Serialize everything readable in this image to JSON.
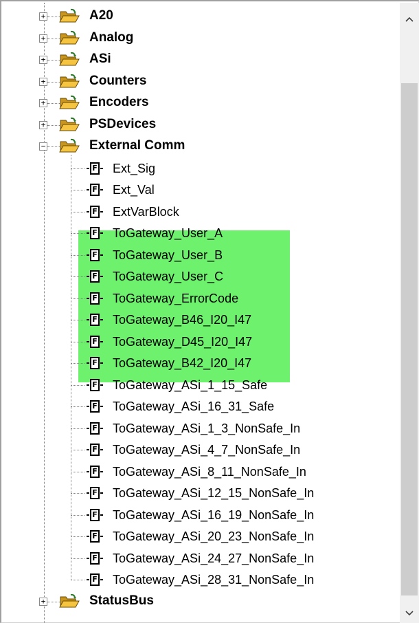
{
  "folders_top": [
    {
      "label": "A20",
      "expander": "+"
    },
    {
      "label": "Analog",
      "expander": "+"
    },
    {
      "label": "ASi",
      "expander": "+"
    },
    {
      "label": "Counters",
      "expander": "+"
    },
    {
      "label": "Encoders",
      "expander": "+"
    },
    {
      "label": "PSDevices",
      "expander": "+"
    }
  ],
  "expanded_folder": {
    "label": "External Comm",
    "expander": "−"
  },
  "function_icon_glyph": "F",
  "functions": [
    {
      "label": "Ext_Sig",
      "highlighted": false
    },
    {
      "label": "Ext_Val",
      "highlighted": false
    },
    {
      "label": "ExtVarBlock",
      "highlighted": false
    },
    {
      "label": "ToGateway_User_A",
      "highlighted": true
    },
    {
      "label": "ToGateway_User_B",
      "highlighted": true
    },
    {
      "label": "ToGateway_User_C",
      "highlighted": true
    },
    {
      "label": "ToGateway_ErrorCode",
      "highlighted": true
    },
    {
      "label": "ToGateway_B46_I20_I47",
      "highlighted": true
    },
    {
      "label": "ToGateway_D45_I20_I47",
      "highlighted": true
    },
    {
      "label": "ToGateway_B42_I20_I47",
      "highlighted": true
    },
    {
      "label": "ToGateway_ASi_1_15_Safe",
      "highlighted": false
    },
    {
      "label": "ToGateway_ASi_16_31_Safe",
      "highlighted": false
    },
    {
      "label": "ToGateway_ASi_1_3_NonSafe_In",
      "highlighted": false
    },
    {
      "label": "ToGateway_ASi_4_7_NonSafe_In",
      "highlighted": false
    },
    {
      "label": "ToGateway_ASi_8_11_NonSafe_In",
      "highlighted": false
    },
    {
      "label": "ToGateway_ASi_12_15_NonSafe_In",
      "highlighted": false
    },
    {
      "label": "ToGateway_ASi_16_19_NonSafe_In",
      "highlighted": false
    },
    {
      "label": "ToGateway_ASi_20_23_NonSafe_In",
      "highlighted": false
    },
    {
      "label": "ToGateway_ASi_24_27_NonSafe_In",
      "highlighted": false
    },
    {
      "label": "ToGateway_ASi_28_31_NonSafe_In",
      "highlighted": false
    }
  ],
  "folders_bottom": [
    {
      "label": "StatusBus",
      "expander": "+"
    }
  ],
  "scrollbar": {
    "up_glyph": "^",
    "down_glyph": "v"
  },
  "colors": {
    "highlight": "#6ef26e",
    "folder": "#f5c542",
    "folder_dark": "#c8961e"
  }
}
